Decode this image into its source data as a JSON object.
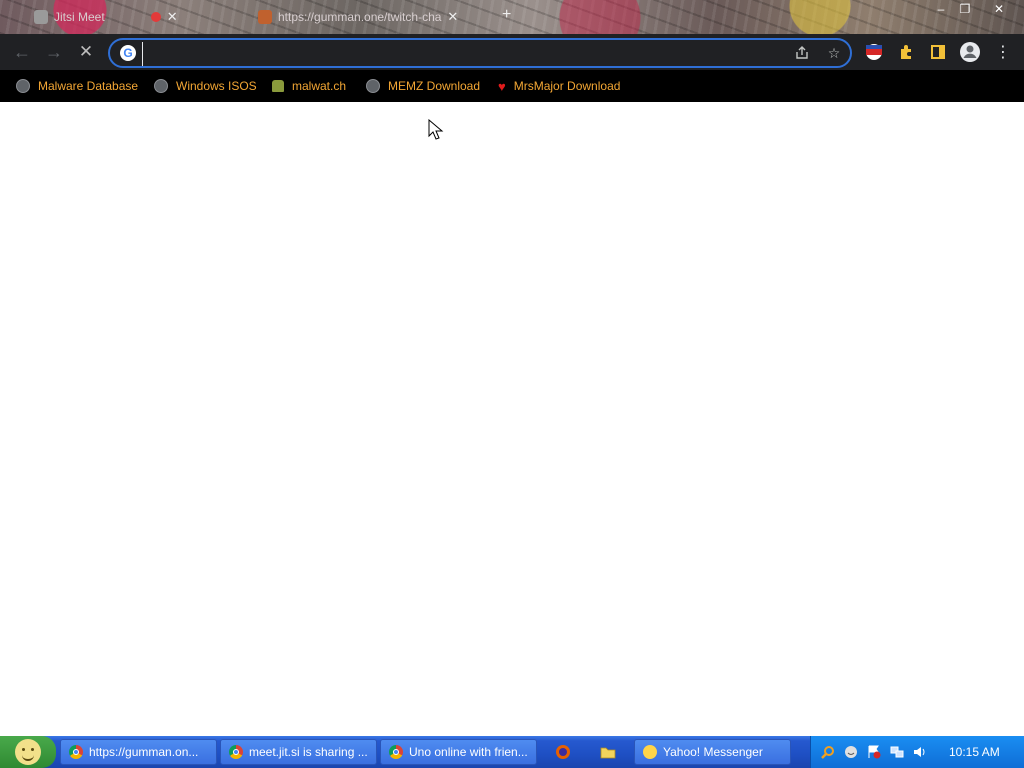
{
  "tabs": [
    {
      "label": "Jitsi Meet",
      "icon": "camera-icon"
    },
    {
      "label": "https://gumman.one/twitch-cha",
      "icon": "site-icon"
    }
  ],
  "window_controls": {
    "minimize": "–",
    "restore": "❐",
    "close": "✕"
  },
  "toolbar": {
    "back": "←",
    "forward": "→",
    "stop": "✕",
    "omnibox_value": "",
    "omnibox_placeholder": ""
  },
  "bookmarks": [
    {
      "label": "Malware Database",
      "icon": "globe-icon"
    },
    {
      "label": "Windows ISOS",
      "icon": "globe-icon"
    },
    {
      "label": "malwat.ch",
      "icon": "person-icon"
    },
    {
      "label": "MEMZ Download",
      "icon": "globe-icon"
    },
    {
      "label": "MrsMajor Download",
      "icon": "heart-icon"
    }
  ],
  "taskbar": {
    "tasks": [
      {
        "label": "https://gumman.on...",
        "icon": "chrome-icon"
      },
      {
        "label": "meet.jit.si is sharing ...",
        "icon": "chrome-icon"
      },
      {
        "label": "Uno online with frien...",
        "icon": "chrome-icon"
      },
      {
        "label": "Yahoo! Messenger",
        "icon": "yahoo-icon"
      }
    ],
    "clock": "10:15 AM"
  },
  "colors": {
    "accent": "#2f6fd6",
    "bookmark_text": "#f2a634",
    "toolbar_bg": "#202124",
    "taskbar_blue": "#2659cf",
    "start_green": "#3a9a3d"
  }
}
